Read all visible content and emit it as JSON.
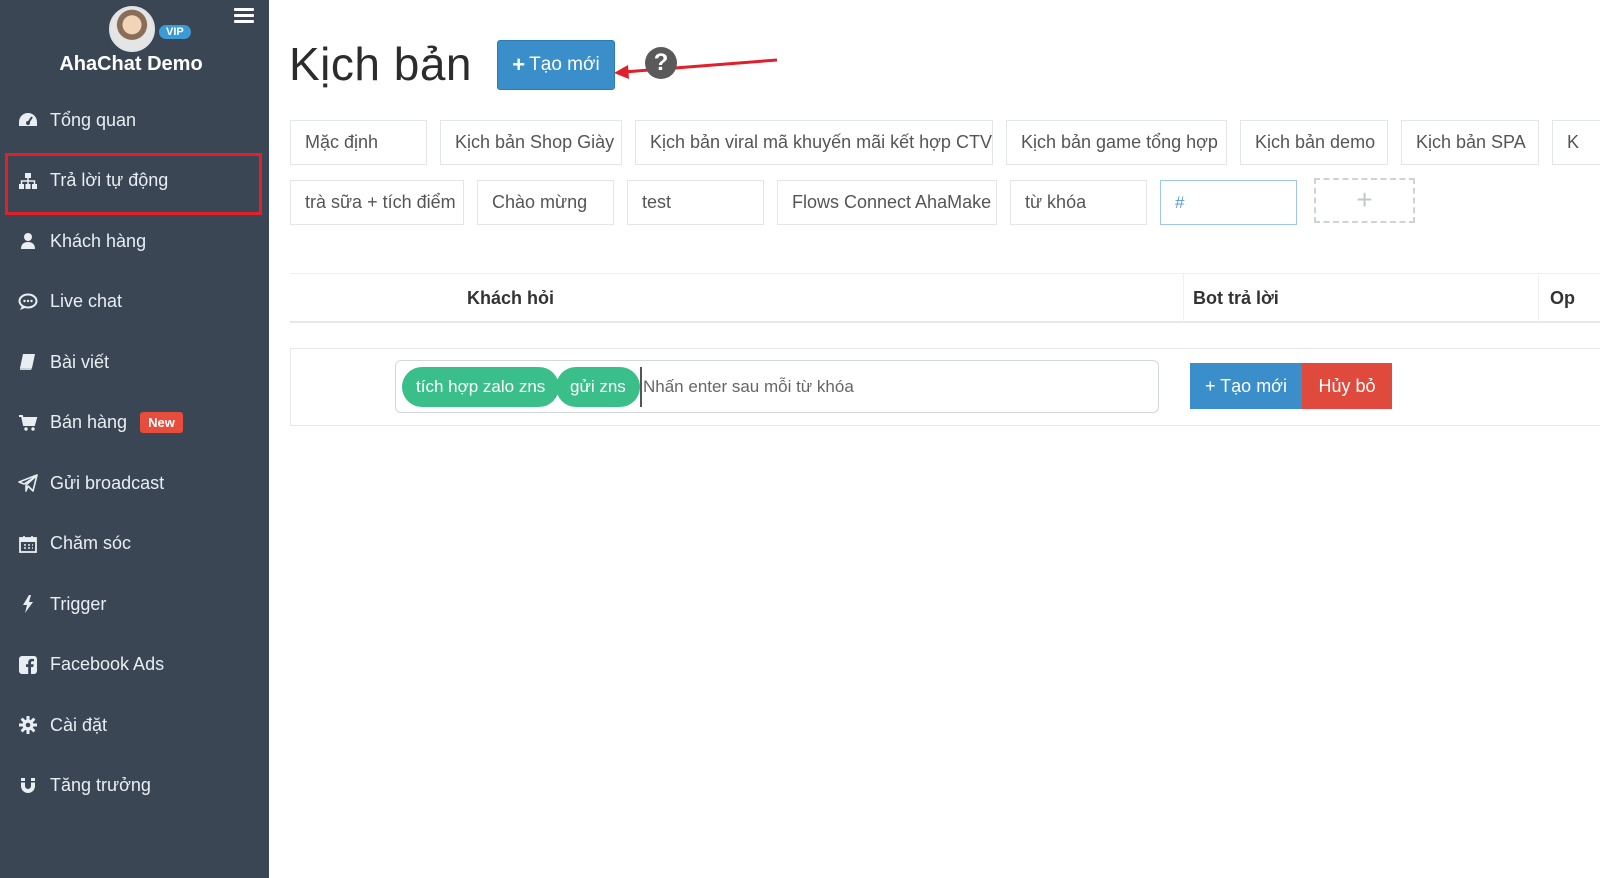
{
  "sidebar": {
    "vip_badge": "VIP",
    "account_name": "AhaChat Demo",
    "items": [
      {
        "label": "Tổng quan",
        "icon": "dashboard-icon"
      },
      {
        "label": "Trả lời tự động",
        "icon": "sitemap-icon",
        "active": true
      },
      {
        "label": "Khách hàng",
        "icon": "user-icon"
      },
      {
        "label": "Live chat",
        "icon": "chat-bubble-icon"
      },
      {
        "label": "Bài viết",
        "icon": "book-icon"
      },
      {
        "label": "Bán hàng",
        "icon": "cart-icon",
        "badge": "New"
      },
      {
        "label": "Gửi broadcast",
        "icon": "paper-plane-icon"
      },
      {
        "label": "Chăm sóc",
        "icon": "calendar-icon"
      },
      {
        "label": "Trigger",
        "icon": "bolt-icon"
      },
      {
        "label": "Facebook Ads",
        "icon": "facebook-icon"
      },
      {
        "label": "Cài đặt",
        "icon": "gear-icon"
      },
      {
        "label": "Tăng trưởng",
        "icon": "magnet-icon"
      }
    ]
  },
  "header": {
    "title": "Kịch bản",
    "create_label": "Tạo mới",
    "help_symbol": "?"
  },
  "scripts": {
    "row1": [
      "Mặc định",
      "Kịch bản Shop Giày",
      "Kịch bản viral mã khuyến mãi kết hợp CTV",
      "Kịch bản game tổng hợp",
      "Kịch bản demo",
      "Kịch bản SPA",
      "K"
    ],
    "row2": [
      "trà sữa + tích điểm",
      "Chào mừng",
      "test",
      "Flows Connect AhaMake",
      "từ khóa"
    ],
    "new_input_placeholder": "#",
    "add_symbol": "+"
  },
  "table": {
    "col_customer": "Khách hỏi",
    "col_bot": "Bot trả lời",
    "col_op": "Op"
  },
  "keyword_row": {
    "chips": [
      "tích hợp zalo zns",
      "gửi zns"
    ],
    "chip_separator": ",",
    "placeholder": "Nhấn enter sau mỗi từ khóa",
    "create_label": "+ Tạo mới",
    "cancel_label": "Hủy bỏ"
  },
  "colors": {
    "sidebar_bg": "#3a4654",
    "primary": "#3a8ec9",
    "danger": "#e04a3c",
    "chip": "#3bbf8a",
    "highlight": "#e0202a"
  }
}
